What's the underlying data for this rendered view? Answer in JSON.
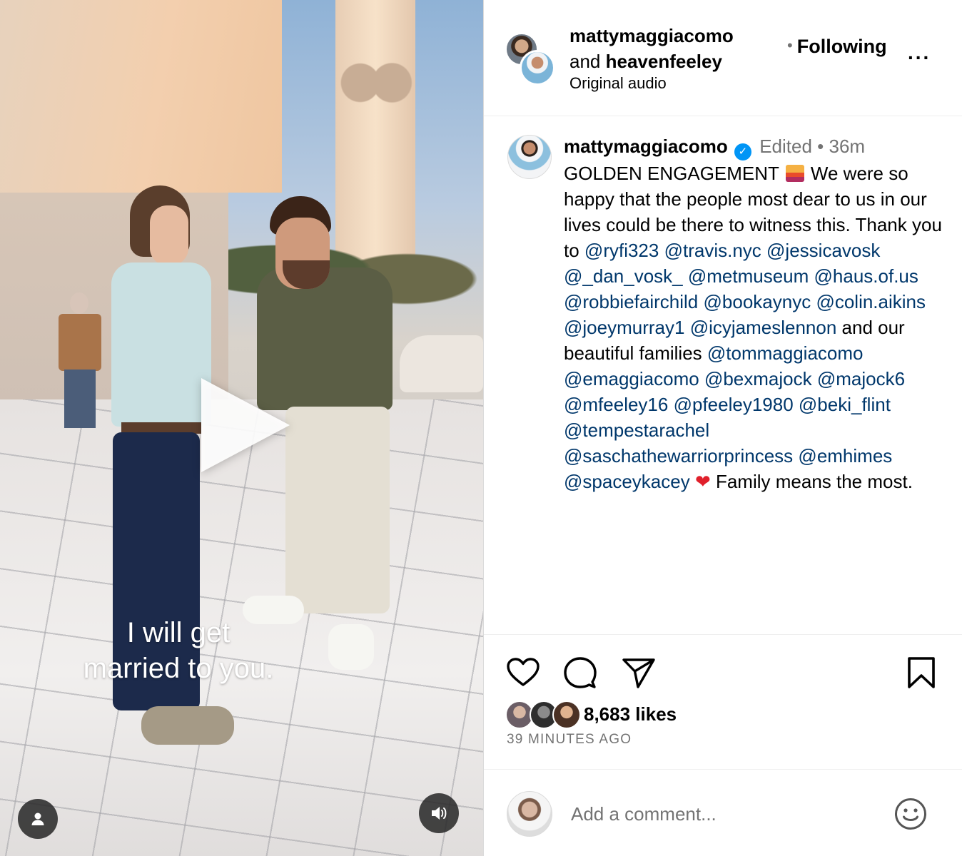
{
  "post": {
    "media": {
      "subtitle_line1": "I will get",
      "subtitle_line2": "married to you.",
      "play_icon": "play-icon",
      "user_icon": "person-icon",
      "sound_icon": "speaker-icon"
    },
    "header": {
      "account1": "mattymaggiacomo",
      "connector": "and",
      "account2": "heavenfeeley",
      "audio_label": "Original audio",
      "follow_dot": "•",
      "follow_label": "Following",
      "more_label": "..."
    },
    "caption": {
      "author": "mattymaggiacomo",
      "verified_icon": "verified-badge-icon",
      "edited_label": "Edited",
      "separator": "•",
      "time_ago": "36m",
      "parts": [
        {
          "text": "GOLDEN ENGAGEMENT ",
          "type": "text"
        },
        {
          "text": "sunset-emoji",
          "type": "emoji"
        },
        {
          "text": " We were so happy that the people most dear to us in our lives could be there to witness this. Thank you to ",
          "type": "text"
        },
        {
          "text": "@ryfi323",
          "type": "mention"
        },
        {
          "text": " ",
          "type": "text"
        },
        {
          "text": "@travis.nyc",
          "type": "mention"
        },
        {
          "text": " ",
          "type": "text"
        },
        {
          "text": "@jessicavosk",
          "type": "mention"
        },
        {
          "text": " ",
          "type": "text"
        },
        {
          "text": "@_dan_vosk_",
          "type": "mention"
        },
        {
          "text": " ",
          "type": "text"
        },
        {
          "text": "@metmuseum",
          "type": "mention"
        },
        {
          "text": " ",
          "type": "text"
        },
        {
          "text": "@haus.of.us",
          "type": "mention"
        },
        {
          "text": " ",
          "type": "text"
        },
        {
          "text": "@robbiefairchild",
          "type": "mention"
        },
        {
          "text": " ",
          "type": "text"
        },
        {
          "text": "@bookaynyc",
          "type": "mention"
        },
        {
          "text": " ",
          "type": "text"
        },
        {
          "text": "@colin.aikins",
          "type": "mention"
        },
        {
          "text": " ",
          "type": "text"
        },
        {
          "text": "@joeymurray1",
          "type": "mention"
        },
        {
          "text": " ",
          "type": "text"
        },
        {
          "text": "@icyjameslennon",
          "type": "mention"
        },
        {
          "text": " and our beautiful families ",
          "type": "text"
        },
        {
          "text": "@tommaggiacomo",
          "type": "mention"
        },
        {
          "text": " ",
          "type": "text"
        },
        {
          "text": "@emaggiacomo",
          "type": "mention"
        },
        {
          "text": " ",
          "type": "text"
        },
        {
          "text": "@bexmajock",
          "type": "mention"
        },
        {
          "text": " ",
          "type": "text"
        },
        {
          "text": "@majock6",
          "type": "mention"
        },
        {
          "text": " ",
          "type": "text"
        },
        {
          "text": "@mfeeley16",
          "type": "mention"
        },
        {
          "text": " ",
          "type": "text"
        },
        {
          "text": "@pfeeley1980",
          "type": "mention"
        },
        {
          "text": " ",
          "type": "text"
        },
        {
          "text": "@beki_flint",
          "type": "mention"
        },
        {
          "text": " ",
          "type": "text"
        },
        {
          "text": "@tempestarachel",
          "type": "mention"
        },
        {
          "text": " ",
          "type": "text"
        },
        {
          "text": "@saschathewarriorprincess",
          "type": "mention"
        },
        {
          "text": " ",
          "type": "text"
        },
        {
          "text": "@emhimes",
          "type": "mention"
        },
        {
          "text": " ",
          "type": "text"
        },
        {
          "text": "@spaceykacey",
          "type": "mention"
        },
        {
          "text": " ",
          "type": "text"
        },
        {
          "text": "red-heart-emoji",
          "type": "heart"
        },
        {
          "text": " Family means the most.",
          "type": "text"
        }
      ]
    },
    "actions": {
      "like_icon": "heart-outline-icon",
      "comment_icon": "comment-bubble-icon",
      "share_icon": "paper-plane-icon",
      "save_icon": "bookmark-icon"
    },
    "likes": {
      "count_label": "8,683 likes"
    },
    "timestamp": "39 MINUTES AGO",
    "comment_box": {
      "placeholder": "Add a comment...",
      "emoji_icon": "smiley-icon"
    }
  },
  "colors": {
    "mention": "#00376b",
    "meta_gray": "#737373",
    "verified_blue": "#0095f6",
    "heart_red": "#e0202b"
  }
}
